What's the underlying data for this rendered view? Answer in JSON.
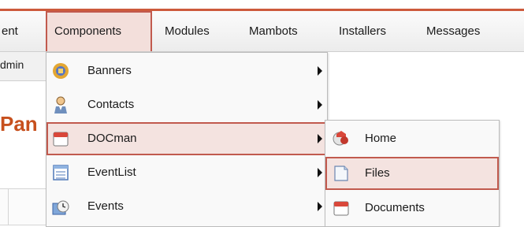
{
  "menubar": {
    "items": [
      {
        "label": "ent"
      },
      {
        "label": "Components",
        "active": true
      },
      {
        "label": "Modules"
      },
      {
        "label": "Mambots"
      },
      {
        "label": "Installers"
      },
      {
        "label": "Messages"
      }
    ]
  },
  "subbar": {
    "label": "dmin"
  },
  "page": {
    "title_fragment": "Pan"
  },
  "components_menu": {
    "items": [
      {
        "label": "Banners",
        "icon": "banners-icon",
        "has_submenu": true
      },
      {
        "label": "Contacts",
        "icon": "contacts-icon",
        "has_submenu": true
      },
      {
        "label": "DOCman",
        "icon": "docman-icon",
        "has_submenu": true,
        "active": true
      },
      {
        "label": "EventList",
        "icon": "eventlist-icon",
        "has_submenu": true
      },
      {
        "label": "Events",
        "icon": "events-icon",
        "has_submenu": true
      }
    ]
  },
  "docman_submenu": {
    "items": [
      {
        "label": "Home",
        "icon": "home-icon"
      },
      {
        "label": "Files",
        "icon": "files-icon",
        "active": true
      },
      {
        "label": "Documents",
        "icon": "documents-icon"
      }
    ]
  },
  "colors": {
    "accent": "#cd5a3c",
    "highlight_border": "#c15a4e",
    "highlight_bg": "#f4e3e0",
    "title": "#c7501e"
  }
}
